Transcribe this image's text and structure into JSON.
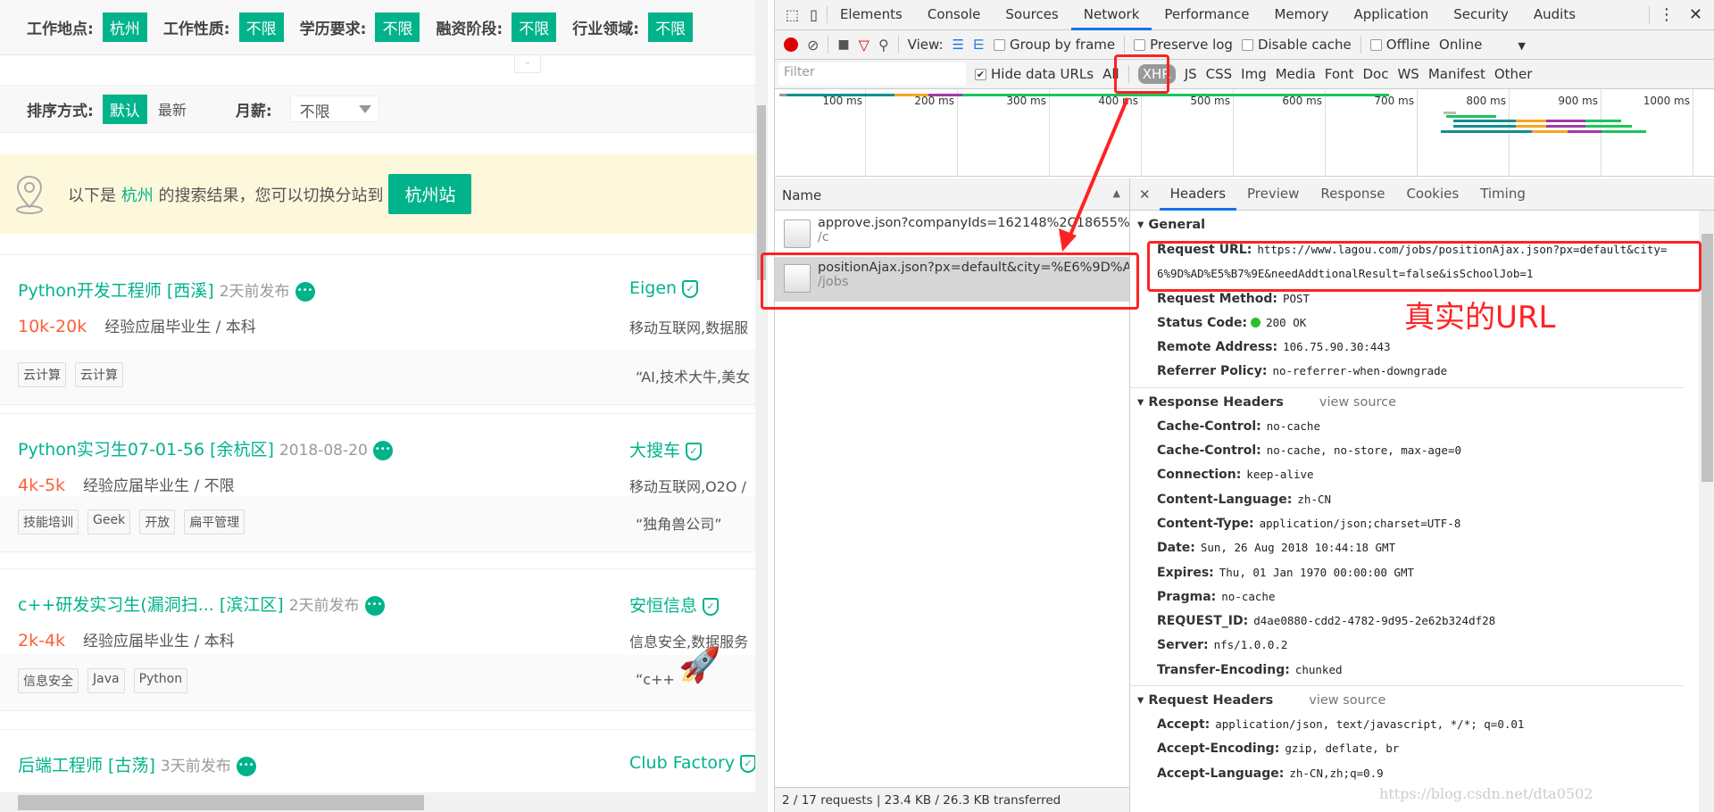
{
  "filters": [
    {
      "label": "工作地点:",
      "value": "杭州"
    },
    {
      "label": "工作性质:",
      "value": "不限"
    },
    {
      "label": "学历要求:",
      "value": "不限"
    },
    {
      "label": "融资阶段:",
      "value": "不限"
    },
    {
      "label": "行业领域:",
      "value": "不限"
    }
  ],
  "sort": {
    "label": "排序方式:",
    "active": "默认",
    "other": "最新",
    "salary_label": "月薪:",
    "salary_value": "不限"
  },
  "banner": {
    "prefix": "以下是",
    "city": "杭州",
    "suffix": "的搜索结果，您可以切换分站到",
    "button": "杭州站"
  },
  "jobs": [
    {
      "title": "Python开发工程师 [西溪]",
      "date": "2天前发布",
      "salary": "10k-20k",
      "req": "经验应届毕业生 / 本科",
      "company": "Eigen",
      "industry": "移动互联网,数据服",
      "tags": [
        "云计算",
        "云计算"
      ],
      "quote": "“AI,技术大牛,美女"
    },
    {
      "title": "Python实习生07-01-56 [余杭区]",
      "date": "2018-08-20",
      "salary": "4k-5k",
      "req": "经验应届毕业生 / 不限",
      "company": "大搜车",
      "industry": "移动互联网,O2O /",
      "tags": [
        "技能培训",
        "Geek",
        "开放",
        "扁平管理"
      ],
      "quote": "“独角兽公司”"
    },
    {
      "title": "c++研发实习生(漏洞扫... [滨江区]",
      "date": "2天前发布",
      "salary": "2k-4k",
      "req": "经验应届毕业生 / 本科",
      "company": "安恒信息",
      "industry": "信息安全,数据服务",
      "tags": [
        "信息安全",
        "Java",
        "Python"
      ],
      "quote": "“c++"
    },
    {
      "title": "后端工程师 [古荡]",
      "date": "3天前发布",
      "salary": "",
      "req": "",
      "company": "Club Factory",
      "industry": "",
      "tags": [],
      "quote": ""
    }
  ],
  "devtools": {
    "tabs": [
      "Elements",
      "Console",
      "Sources",
      "Network",
      "Performance",
      "Memory",
      "Application",
      "Security",
      "Audits"
    ],
    "active_tab": "Network",
    "toolbar": {
      "view": "View:",
      "group_by_frame": "Group by frame",
      "preserve_log": "Preserve log",
      "disable_cache": "Disable cache",
      "offline": "Offline",
      "throttle": "Online"
    },
    "filter": {
      "placeholder": "Filter",
      "hide_data_urls": "Hide data URLs",
      "types": [
        "All",
        "XHR",
        "JS",
        "CSS",
        "Img",
        "Media",
        "Font",
        "Doc",
        "WS",
        "Manifest",
        "Other"
      ],
      "active_type": "XHR"
    },
    "timeline_ticks": [
      "100 ms",
      "200 ms",
      "300 ms",
      "400 ms",
      "500 ms",
      "600 ms",
      "700 ms",
      "800 ms",
      "900 ms",
      "1000 ms"
    ],
    "name_header": "Name",
    "requests": [
      {
        "name": "approve.json?companyIds=162148%2C18655%2C...",
        "path": "/c"
      },
      {
        "name": "positionAjax.json?px=default&city=%E6%9D%AD...",
        "path": "/jobs",
        "selected": true
      }
    ],
    "status_bar": "2 / 17 requests  |  23.4 KB / 26.3 KB transferred",
    "detail_tabs": [
      "Headers",
      "Preview",
      "Response",
      "Cookies",
      "Timing"
    ],
    "active_detail_tab": "Headers",
    "general": {
      "title": "General",
      "rows": [
        {
          "k": "Request URL:",
          "v": "https://www.lagou.com/jobs/positionAjax.json?px=default&city="
        },
        {
          "k": "",
          "v": "6%9D%AD%E5%B7%9E&needAddtionalResult=false&isSchoolJob=1"
        },
        {
          "k": "Request Method:",
          "v": "POST"
        },
        {
          "k": "Status Code:",
          "v": "200 OK"
        },
        {
          "k": "Remote Address:",
          "v": "106.75.90.30:443"
        },
        {
          "k": "Referrer Policy:",
          "v": "no-referrer-when-downgrade"
        }
      ]
    },
    "response_headers": {
      "title": "Response Headers",
      "view_source": "view source",
      "rows": [
        {
          "k": "Cache-Control:",
          "v": "no-cache"
        },
        {
          "k": "Cache-Control:",
          "v": "no-cache, no-store, max-age=0"
        },
        {
          "k": "Connection:",
          "v": "keep-alive"
        },
        {
          "k": "Content-Language:",
          "v": "zh-CN"
        },
        {
          "k": "Content-Type:",
          "v": "application/json;charset=UTF-8"
        },
        {
          "k": "Date:",
          "v": "Sun, 26 Aug 2018 10:44:18 GMT"
        },
        {
          "k": "Expires:",
          "v": "Thu, 01 Jan 1970 00:00:00 GMT"
        },
        {
          "k": "Pragma:",
          "v": "no-cache"
        },
        {
          "k": "REQUEST_ID:",
          "v": "d4ae0880-cdd2-4782-9d95-2e62b324df28"
        },
        {
          "k": "Server:",
          "v": "nfs/1.0.0.2"
        },
        {
          "k": "Transfer-Encoding:",
          "v": "chunked"
        }
      ]
    },
    "request_headers": {
      "title": "Request Headers",
      "view_source": "view source",
      "rows": [
        {
          "k": "Accept:",
          "v": "application/json, text/javascript, */*; q=0.01"
        },
        {
          "k": "Accept-Encoding:",
          "v": "gzip, deflate, br"
        },
        {
          "k": "Accept-Language:",
          "v": "zh-CN,zh;q=0.9"
        }
      ]
    }
  },
  "annotation": "真实的URL",
  "watermark": "https://blog.csdn.net/dta0502",
  "colors": {
    "brand": "#00b38a",
    "salary": "#fd5f39",
    "annotation": "#ff2222",
    "devtools_accent": "#1a73e8"
  }
}
